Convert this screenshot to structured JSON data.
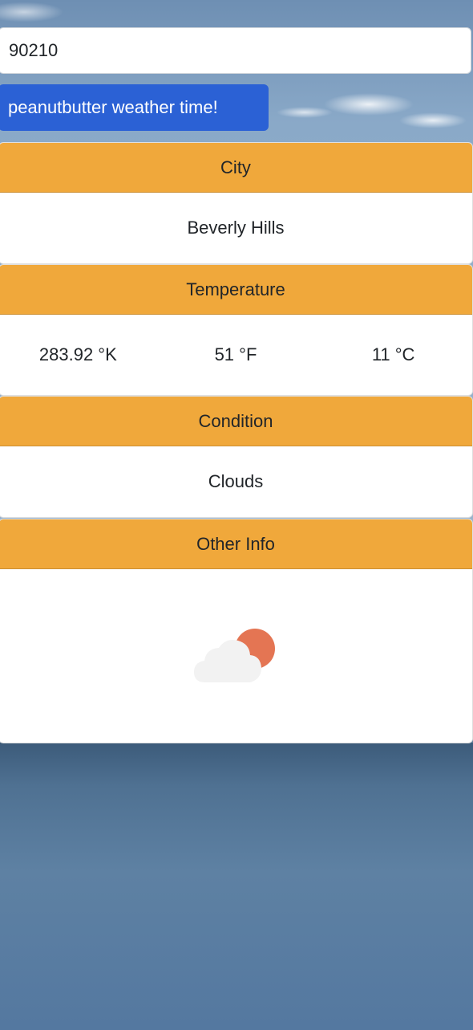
{
  "search": {
    "value": "90210",
    "placeholder": ""
  },
  "submit_button": {
    "label": "peanutbutter weather time!"
  },
  "city": {
    "header": "City",
    "value": "Beverly Hills"
  },
  "temperature": {
    "header": "Temperature",
    "kelvin": "283.92 °K",
    "fahrenheit": "51 °F",
    "celsius": "11 °C"
  },
  "condition": {
    "header": "Condition",
    "value": "Clouds"
  },
  "other_info": {
    "header": "Other Info",
    "icon": "partly-cloudy-icon"
  },
  "colors": {
    "accent_header": "#f0a83b",
    "button": "#2b61d5",
    "sun": "#e47553",
    "cloud": "#f2f2f2"
  }
}
